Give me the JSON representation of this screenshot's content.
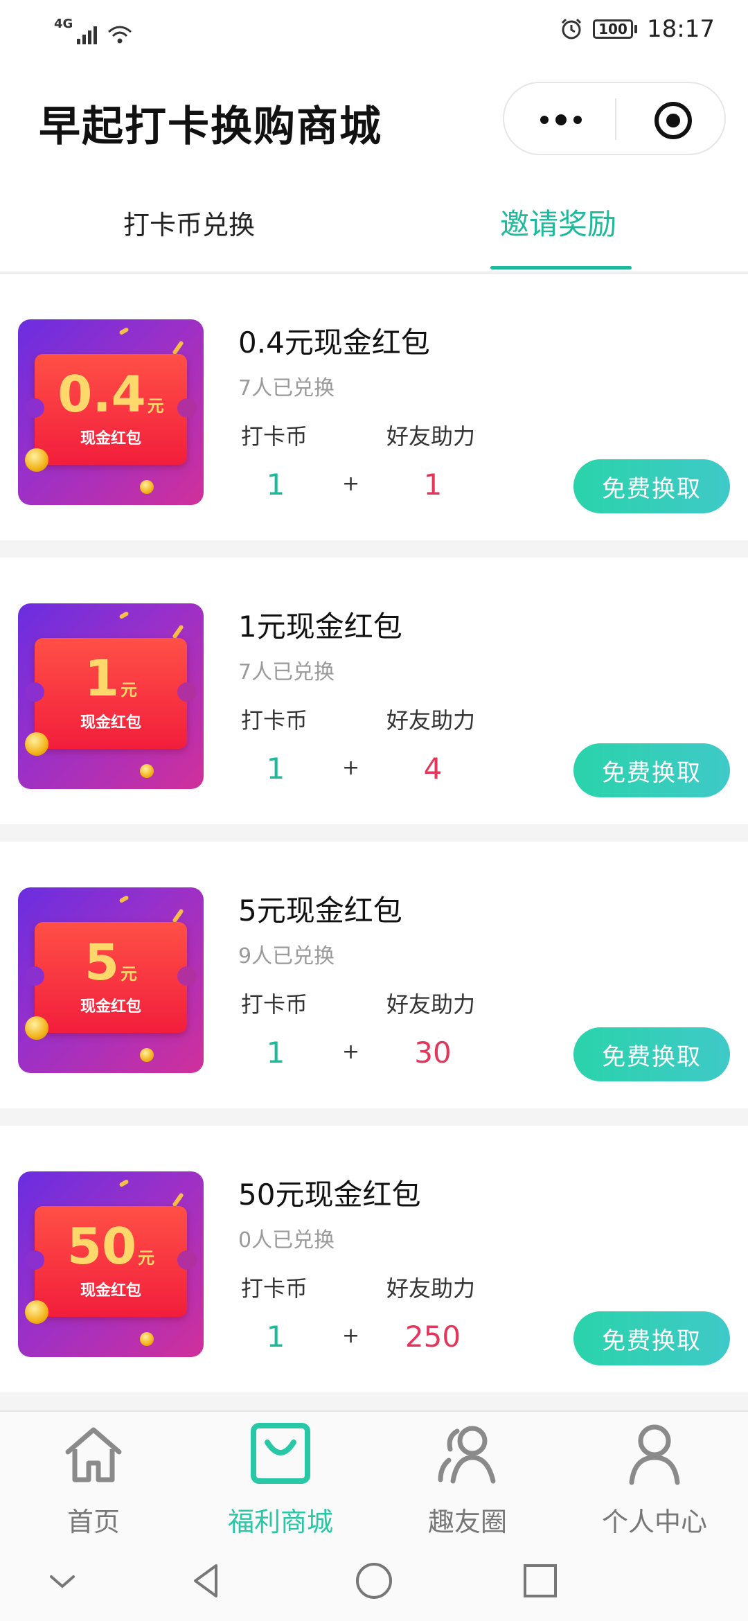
{
  "status_bar": {
    "network": "4G",
    "battery": "100",
    "time": "18:17"
  },
  "app": {
    "title": "早起打卡换购商城"
  },
  "tabs": [
    {
      "label": "打卡币兑换",
      "active": false
    },
    {
      "label": "邀请奖励",
      "active": true
    }
  ],
  "products": [
    {
      "title": "0.4元现金红包",
      "ticket_amount": "0.4",
      "ticket_unit": "元",
      "ticket_label": "现金红包",
      "sold": "7人已兑换",
      "coin_label": "打卡币",
      "coin": "1",
      "plus": "+",
      "help_label": "好友助力",
      "help": "1",
      "button": "免费换取"
    },
    {
      "title": "1元现金红包",
      "ticket_amount": "1",
      "ticket_unit": "元",
      "ticket_label": "现金红包",
      "sold": "7人已兑换",
      "coin_label": "打卡币",
      "coin": "1",
      "plus": "+",
      "help_label": "好友助力",
      "help": "4",
      "button": "免费换取"
    },
    {
      "title": "5元现金红包",
      "ticket_amount": "5",
      "ticket_unit": "元",
      "ticket_label": "现金红包",
      "sold": "9人已兑换",
      "coin_label": "打卡币",
      "coin": "1",
      "plus": "+",
      "help_label": "好友助力",
      "help": "30",
      "button": "免费换取"
    },
    {
      "title": "50元现金红包",
      "ticket_amount": "50",
      "ticket_unit": "元",
      "ticket_label": "现金红包",
      "sold": "0人已兑换",
      "coin_label": "打卡币",
      "coin": "1",
      "plus": "+",
      "help_label": "好友助力",
      "help": "250",
      "button": "免费换取"
    }
  ],
  "tabbar": [
    {
      "label": "首页",
      "icon": "home-icon",
      "active": false
    },
    {
      "label": "福利商城",
      "icon": "shopping-bag-icon",
      "active": true
    },
    {
      "label": "趣友圈",
      "icon": "friends-icon",
      "active": false
    },
    {
      "label": "个人中心",
      "icon": "person-icon",
      "active": false
    }
  ],
  "colors": {
    "accent": "#1db99a",
    "help_value": "#e4355a",
    "button": "#2ad3aa"
  }
}
